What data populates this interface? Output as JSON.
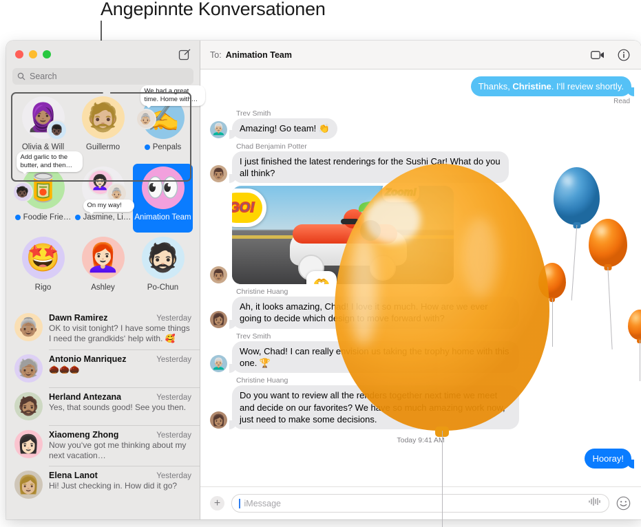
{
  "callout": {
    "label": "Angepinnte Konversationen"
  },
  "window": {
    "traffic_lights": [
      "close-button",
      "minimize-button",
      "zoom-button"
    ],
    "compose_icon": "compose-icon"
  },
  "sidebar": {
    "search": {
      "placeholder": "Search",
      "icon": "search-icon"
    },
    "pinned": [
      {
        "name": "Olivia & Will",
        "unread": false,
        "avatar_emoji": "🧕🏽",
        "bg": "#efedf0",
        "mini_emoji": "👦🏿",
        "mini_bg": "#cfe6f7",
        "tapback": ""
      },
      {
        "name": "Guillermo",
        "unread": false,
        "avatar_emoji": "🧔🏼",
        "bg": "#fbdfa9",
        "mini_emoji": "",
        "mini_bg": "",
        "tapback": ""
      },
      {
        "name": "Penpals",
        "unread": true,
        "avatar_emoji": "✍️",
        "bg": "#8fc7e8",
        "mini_emoji": "👵🏼",
        "mini_bg": "#e7ded6",
        "tapback": "We had a great time. Home with…"
      },
      {
        "name": "Foodie Frie…",
        "unread": true,
        "avatar_emoji": "🥫",
        "bg": "#b6e7a4",
        "mini_emoji": "🧒🏿",
        "mini_bg": "#ded3f0",
        "tapback": "Add garlic to the butter, and then…"
      },
      {
        "name": "Jasmine, Li…",
        "unread": true,
        "avatar_emoji": "👩🏻‍🦱",
        "bg": "#efedf0",
        "mini_emoji": "👵🏼",
        "mini_bg": "#e8e0d8",
        "tapback": "On my way!"
      },
      {
        "name": "Animation Team",
        "unread": false,
        "avatar_emoji": "👀",
        "bg": "#f2a0dd",
        "mini_emoji": "",
        "mini_bg": "",
        "tapback": "",
        "selected": true
      },
      {
        "name": "Rigo",
        "unread": false,
        "avatar_emoji": "🤩",
        "bg": "#d9cdf7",
        "mini_emoji": "",
        "mini_bg": "",
        "tapback": ""
      },
      {
        "name": "Ashley",
        "unread": false,
        "avatar_emoji": "👩🏻‍🦰",
        "bg": "#f9c5bd",
        "mini_emoji": "",
        "mini_bg": "",
        "tapback": ""
      },
      {
        "name": "Po-Chun",
        "unread": false,
        "avatar_emoji": "🧔🏻",
        "bg": "#cfeaf7",
        "mini_emoji": "",
        "mini_bg": "",
        "tapback": ""
      }
    ],
    "conversations": [
      {
        "name": "Dawn Ramirez",
        "time": "Yesterday",
        "preview": "OK to visit tonight? I have some things I need the grandkids‘ help with. 🥰",
        "avatar_emoji": "👵🏽",
        "bg": "#fadfb4"
      },
      {
        "name": "Antonio Manriquez",
        "time": "Yesterday",
        "preview": "🌰🌰🌰",
        "avatar_emoji": "🧓🏽",
        "bg": "#ddd0f5"
      },
      {
        "name": "Herland Antezana",
        "time": "Yesterday",
        "preview": "Yes, that sounds good! See you then.",
        "avatar_emoji": "🧔🏽",
        "bg": "#cdd8c2"
      },
      {
        "name": "Xiaomeng Zhong",
        "time": "Yesterday",
        "preview": "Now you‘ve got me thinking about my next vacation…",
        "avatar_emoji": "👩🏻",
        "bg": "#fac4cf"
      },
      {
        "name": "Elena Lanot",
        "time": "Yesterday",
        "preview": "Hi! Just checking in. How did it go?",
        "avatar_emoji": "👩🏼",
        "bg": "#cfc6b8"
      }
    ]
  },
  "thread": {
    "to_label": "To:",
    "to_value": "Animation Team",
    "facetime_icon": "video-camera-icon",
    "info_icon": "info-icon",
    "messages": [
      {
        "kind": "out",
        "style": "lightblue",
        "text_prefix": "Thanks, ",
        "text_bold": "Christine",
        "text_suffix": ". I‘ll review shortly.",
        "status": "Read"
      },
      {
        "kind": "in",
        "sender": "Trev Smith",
        "text": "Amazing! Go team! 👏",
        "avatar_emoji": "👨🏼‍🦳",
        "bg": "#9fc5d8"
      },
      {
        "kind": "in",
        "sender": "Chad Benjamin Potter",
        "text": "I just finished the latest renderings for the Sushi Car! What do you all think?",
        "avatar_emoji": "👨🏽",
        "bg": "#c9a88a"
      },
      {
        "kind": "attachment",
        "avatar_emoji": "👨🏽",
        "bg": "#c9a88a",
        "stickers": [
          "GO!",
          "Zoom!",
          "🫶"
        ]
      },
      {
        "kind": "in",
        "sender": "Christine Huang",
        "text": "Ah, it looks amazing, Chad! I love it so much. How are we ever going to decide which design to move forward with?",
        "avatar_emoji": "👩🏽",
        "bg": "#b0886c"
      },
      {
        "kind": "in",
        "sender": "Trev Smith",
        "text": "Wow, Chad! I can really envision us taking the trophy home with this one. 🏆",
        "avatar_emoji": "👨🏼‍🦳",
        "bg": "#9fc5d8"
      },
      {
        "kind": "in",
        "sender": "Christine Huang",
        "text": "Do you want to review all the renders together next time we meet and decide on our favorites? We have so much amazing work now, just need to make some decisions.",
        "avatar_emoji": "👩🏽",
        "bg": "#b0886c"
      }
    ],
    "timestamp": "Today 9:41 AM",
    "last_message": {
      "kind": "out",
      "style": "blue",
      "text": "Hooray!"
    },
    "composer": {
      "add_icon": "plus-icon",
      "placeholder": "iMessage",
      "audio_icon": "audio-waveform-icon",
      "emoji_icon": "smiley-face-icon"
    }
  },
  "effects": {
    "name": "balloons-screen-effect",
    "balloons": [
      {
        "id": "balloon-big",
        "color": "#f5a518"
      },
      {
        "id": "balloon-blue",
        "color": "#3f8fc6"
      },
      {
        "id": "balloon-or1",
        "color": "#f8871a"
      },
      {
        "id": "balloon-or2",
        "color": "#f8871a"
      },
      {
        "id": "balloon-or3",
        "color": "#f8871a"
      }
    ]
  }
}
